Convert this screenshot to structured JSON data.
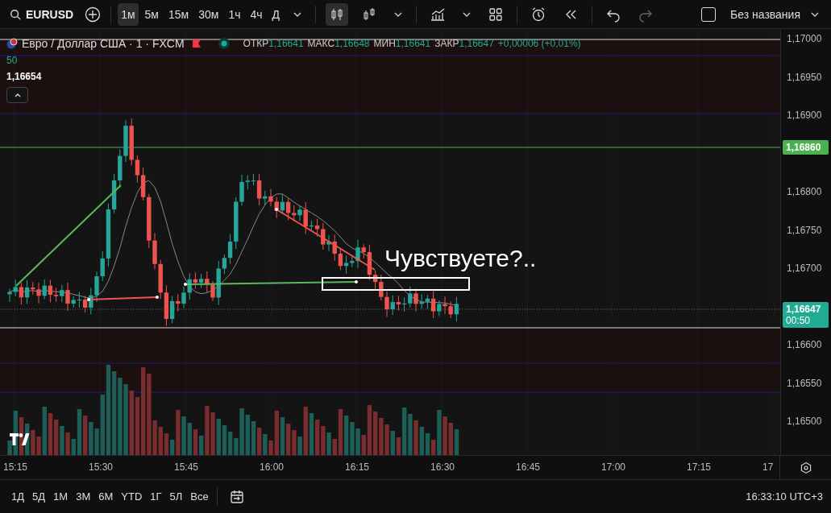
{
  "toolbar": {
    "symbol": "EURUSD",
    "intervals": [
      {
        "label": "1м",
        "selected": true
      },
      {
        "label": "5м",
        "selected": false
      },
      {
        "label": "15м",
        "selected": false
      },
      {
        "label": "30м",
        "selected": false
      },
      {
        "label": "1ч",
        "selected": false
      },
      {
        "label": "4ч",
        "selected": false
      },
      {
        "label": "Д",
        "selected": false
      }
    ],
    "chart_styles": [
      {
        "kind": "candles",
        "selected": true
      },
      {
        "kind": "bars",
        "selected": false
      }
    ],
    "checkbox": {
      "checked": false
    },
    "layout_title": "Без названия"
  },
  "legend": {
    "title": "Евро / Доллар США · 1 · FXCM",
    "ohlc": [
      {
        "label": "ОТКР",
        "value": "1,16641"
      },
      {
        "label": "МАКС",
        "value": "1,16648"
      },
      {
        "label": "МИН",
        "value": "1,16641"
      },
      {
        "label": "ЗАКР",
        "value": "1,16647"
      }
    ],
    "change": "+0,00006 (+0,01%)",
    "indicator": {
      "length": "50",
      "value": "1,16654"
    }
  },
  "annotation": "Чувствуете?..",
  "price_axis": {
    "labels": [
      "1,17000",
      "1,16950",
      "1,16900",
      "1,16800",
      "1,16750",
      "1,16700",
      "1,16600",
      "1,16550",
      "1,16500"
    ],
    "badges": [
      {
        "price": "1,16860",
        "color": "#4caf50"
      },
      {
        "price": "1,16647",
        "countdown": "00:50",
        "color": "#22ab94"
      }
    ]
  },
  "time_axis": {
    "labels": [
      "15:15",
      "15:30",
      "15:45",
      "16:00",
      "16:15",
      "16:30",
      "16:45",
      "17:00",
      "17:15",
      "17"
    ]
  },
  "ranges": [
    "1Д",
    "5Д",
    "1М",
    "3М",
    "6М",
    "YTD",
    "1Г",
    "5Л",
    "Все"
  ],
  "clock": "16:33:10 UTC+3"
}
